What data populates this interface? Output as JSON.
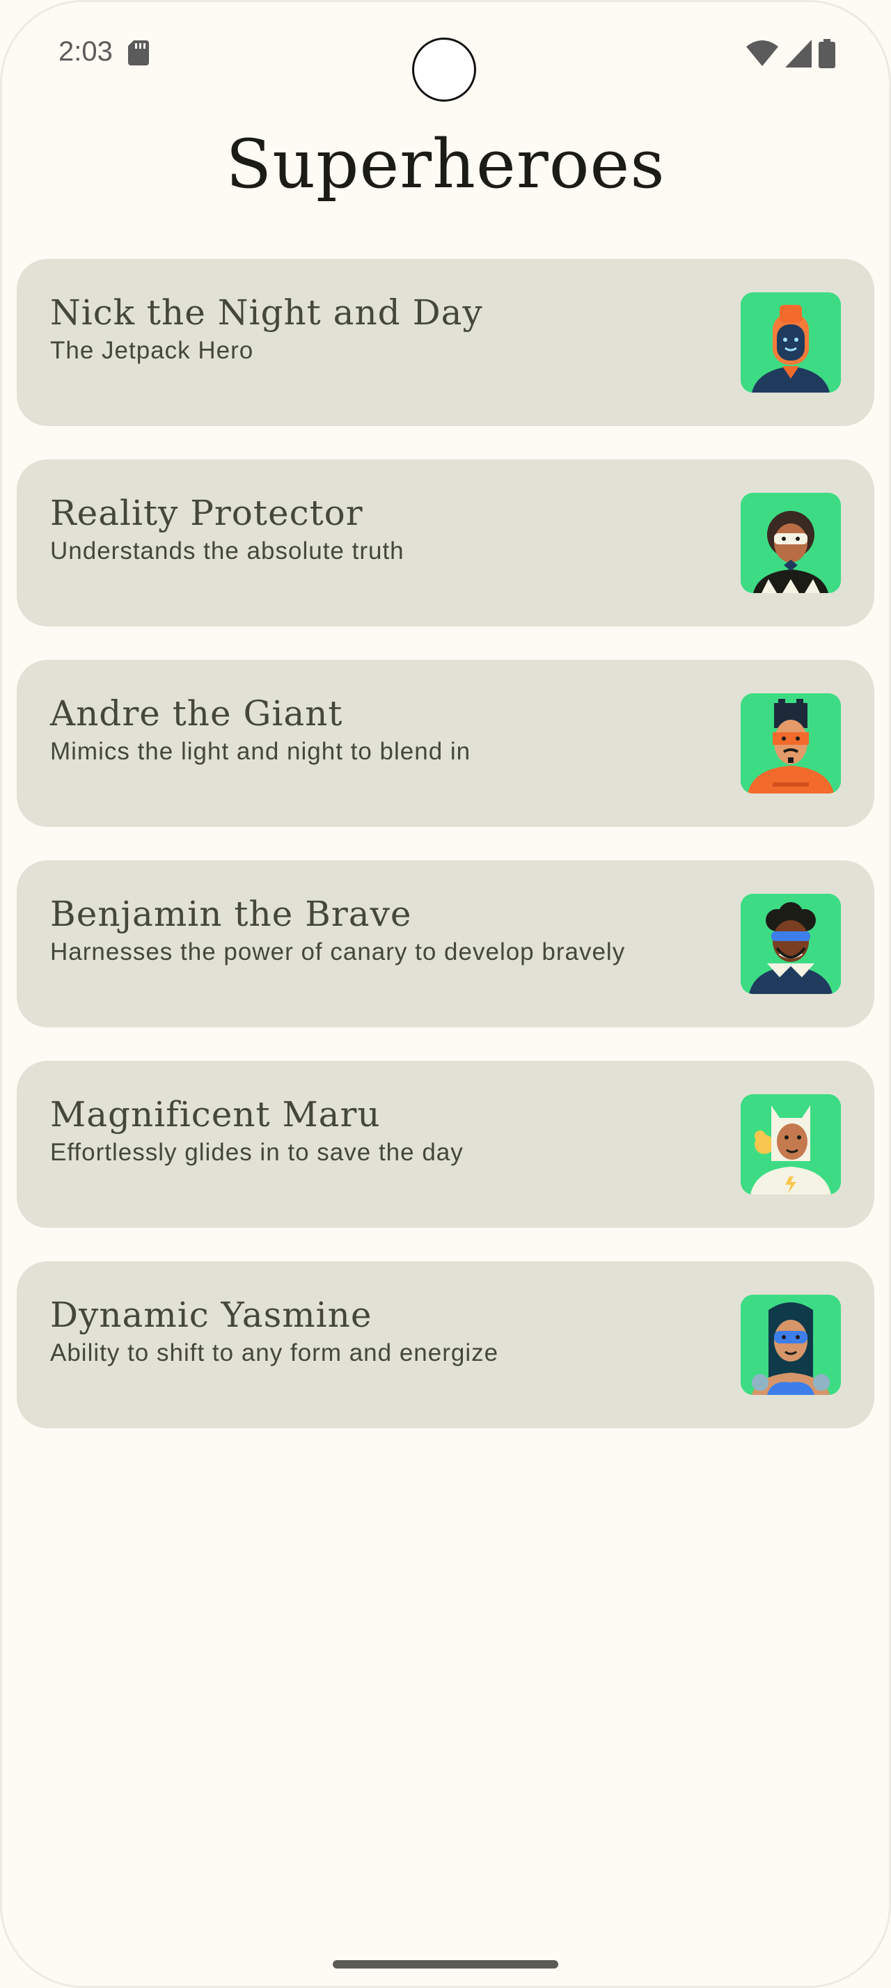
{
  "status_bar": {
    "time": "2:03",
    "icons": [
      "sd-card-icon",
      "wifi-icon",
      "cell-signal-icon",
      "battery-icon"
    ]
  },
  "app": {
    "title": "Superheroes"
  },
  "heroes": [
    {
      "name": "Nick the Night and Day",
      "description": "The Jetpack Hero",
      "avatar": "hero-1-avatar"
    },
    {
      "name": "Reality Protector",
      "description": "Understands the absolute truth",
      "avatar": "hero-2-avatar"
    },
    {
      "name": "Andre the Giant",
      "description": "Mimics the light and night to blend in",
      "avatar": "hero-3-avatar"
    },
    {
      "name": "Benjamin the Brave",
      "description": "Harnesses the power of canary to develop bravely",
      "avatar": "hero-4-avatar"
    },
    {
      "name": "Magnificent Maru",
      "description": "Effortlessly glides in to save the day",
      "avatar": "hero-5-avatar"
    },
    {
      "name": "Dynamic Yasmine",
      "description": "Ability to shift to any form and energize",
      "avatar": "hero-6-avatar"
    }
  ],
  "colors": {
    "background": "#fdfbf4",
    "card": "#e1e2d5",
    "card_text": "#45463c",
    "title_text": "#1c1c17",
    "avatar_bg": "#3ddc84"
  }
}
